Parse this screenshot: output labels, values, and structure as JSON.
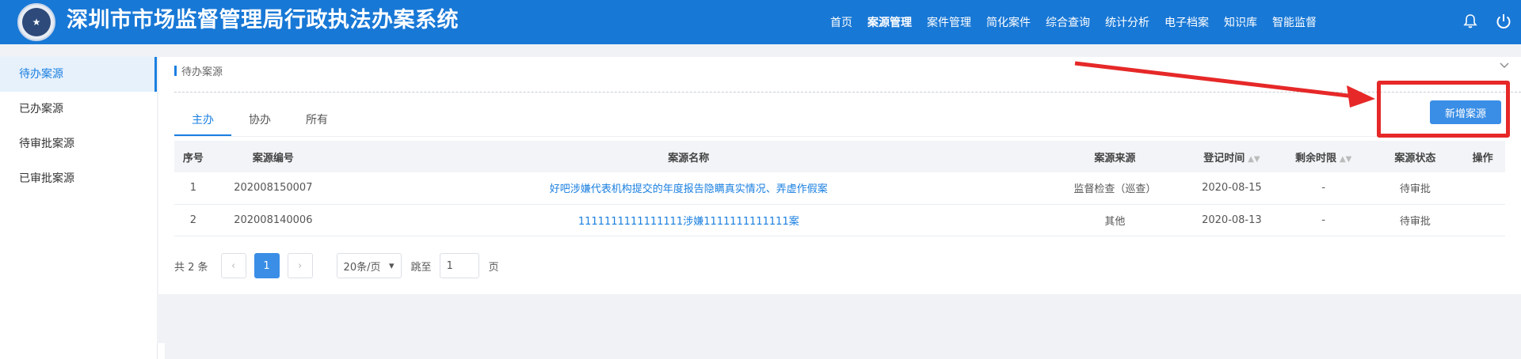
{
  "header": {
    "title": "深圳市市场监督管理局行政执法办案系统",
    "nav": [
      "首页",
      "案源管理",
      "案件管理",
      "简化案件",
      "综合查询",
      "统计分析",
      "电子档案",
      "知识库",
      "智能监督"
    ],
    "active_nav": "案源管理",
    "icons": [
      "bell-icon",
      "power-icon"
    ]
  },
  "sidebar": {
    "items": [
      {
        "label": "待办案源",
        "active": true
      },
      {
        "label": "已办案源",
        "active": false
      },
      {
        "label": "待审批案源",
        "active": false
      },
      {
        "label": "已审批案源",
        "active": false
      }
    ]
  },
  "main": {
    "breadcrumb": "待办案源",
    "tabs": [
      "主办",
      "协办",
      "所有"
    ],
    "add_button": "新增案源",
    "table": {
      "columns": [
        "序号",
        "案源编号",
        "案源名称",
        "案源来源",
        "登记时间",
        "剩余时限",
        "案源状态",
        "操作"
      ],
      "rows": [
        [
          "1",
          "202008150007",
          "好吧涉嫌代表机构提交的年度报告隐瞒真实情况、弄虚作假案",
          "监督检查（巡查）",
          "2020-08-15",
          "-",
          "待审批",
          ""
        ],
        [
          "2",
          "202008140006",
          "1111111111111111涉嫌1111111111111案",
          "其他",
          "2020-08-13",
          "-",
          "待审批",
          ""
        ]
      ]
    },
    "pagination": {
      "total": "共 2 条",
      "prev": "‹",
      "current": "1",
      "next": "›",
      "page_size": "20条/页",
      "jump_label": "跳至",
      "jump_value": "1",
      "page_unit": "页"
    }
  },
  "colors": {
    "header_bg": "#1878d6",
    "accent": "#1a7fe0",
    "highlight": "#e62828"
  }
}
